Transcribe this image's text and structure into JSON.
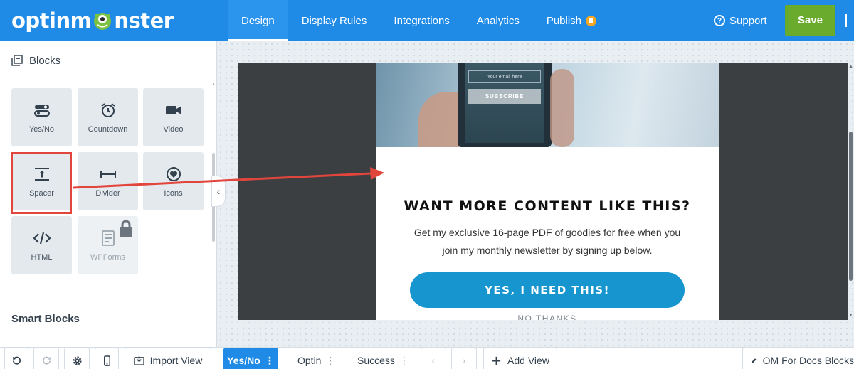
{
  "brand": {
    "logo_text_before": "optinm",
    "logo_text_after": "nster"
  },
  "nav": {
    "items": [
      {
        "label": "Design"
      },
      {
        "label": "Display Rules"
      },
      {
        "label": "Integrations"
      },
      {
        "label": "Analytics"
      },
      {
        "label": "Publish"
      }
    ],
    "support_label": "Support",
    "save_label": "Save"
  },
  "sidebar": {
    "header": "Blocks",
    "blocks": [
      {
        "label": "Yes/No",
        "icon": "yes-no-icon"
      },
      {
        "label": "Countdown",
        "icon": "alarm-clock-icon"
      },
      {
        "label": "Video",
        "icon": "video-camera-icon"
      },
      {
        "label": "Spacer",
        "icon": "spacer-icon"
      },
      {
        "label": "Divider",
        "icon": "divider-icon"
      },
      {
        "label": "Icons",
        "icon": "heart-circle-icon"
      },
      {
        "label": "HTML",
        "icon": "code-icon"
      },
      {
        "label": "WPForms",
        "icon": "form-icon",
        "locked": true
      }
    ],
    "smart_blocks_label": "Smart Blocks"
  },
  "popup": {
    "phone_email_placeholder": "Your email here",
    "phone_subscribe": "SUBSCRIBE",
    "heading": "WANT MORE CONTENT LIKE THIS?",
    "body_line1": "Get my exclusive 16-page PDF of goodies for free when you",
    "body_line2": "join my monthly newsletter by signing up below.",
    "cta": "YES, I NEED THIS!",
    "no_thanks": "NO THANKS"
  },
  "bottom": {
    "import_view": "Import View",
    "views": [
      {
        "label": "Yes/No"
      },
      {
        "label": "Optin"
      },
      {
        "label": "Success"
      }
    ],
    "add_view": "Add View",
    "campaign_name": "OM For Docs Blocks"
  },
  "colors": {
    "brand_blue": "#1f8be6",
    "save_green": "#6aab2e",
    "cta_blue": "#1795cf",
    "highlight_red": "#e2453c",
    "publish_orange": "#f5a623"
  }
}
